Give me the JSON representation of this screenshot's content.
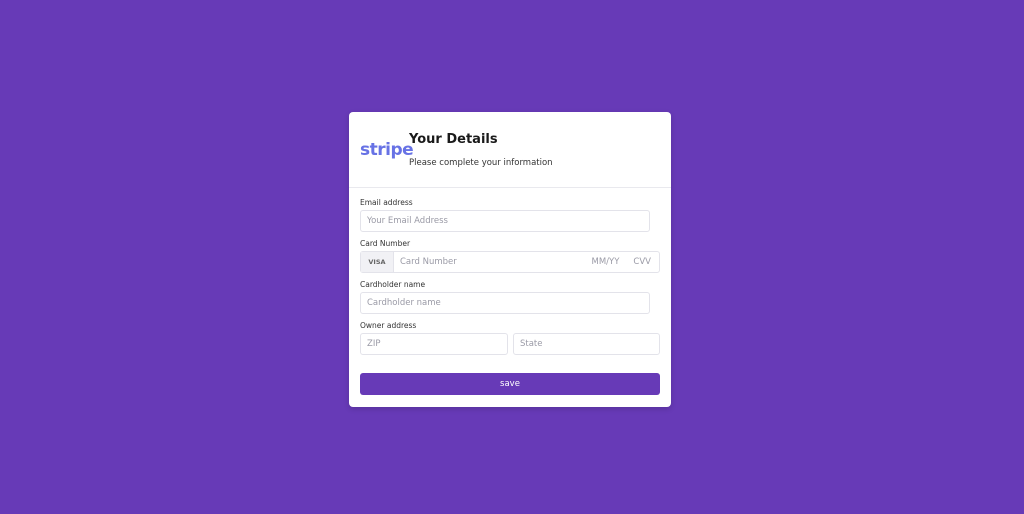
{
  "colors": {
    "background": "#673ab7",
    "brand": "#6772e5",
    "button": "#673ab7"
  },
  "header": {
    "logo_text": "stripe",
    "title": "Your Details",
    "subtitle": "Please complete your information"
  },
  "form": {
    "email": {
      "label": "Email address",
      "placeholder": "Your Email Address",
      "value": ""
    },
    "card": {
      "label": "Card Number",
      "brand_badge": "VISA",
      "number_placeholder": "Card Number",
      "expiry_placeholder": "MM/YY",
      "cvv_placeholder": "CVV"
    },
    "cardholder": {
      "label": "Cardholder name",
      "placeholder": "Cardholder name",
      "value": ""
    },
    "address": {
      "label": "Owner address",
      "zip_placeholder": "ZIP",
      "state_placeholder": "State"
    },
    "save_label": "save"
  }
}
